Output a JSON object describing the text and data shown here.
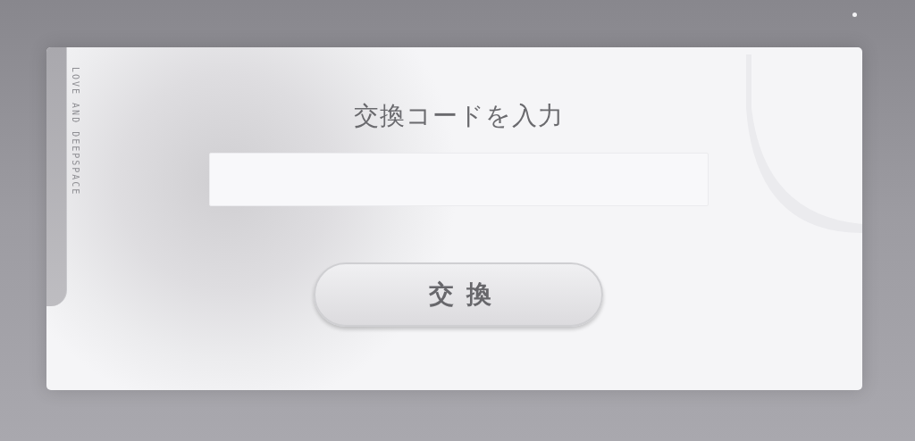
{
  "dialog": {
    "side_text": "LOVE AND DEEPSPACE",
    "title": "交換コードを入力",
    "button": "交換"
  }
}
